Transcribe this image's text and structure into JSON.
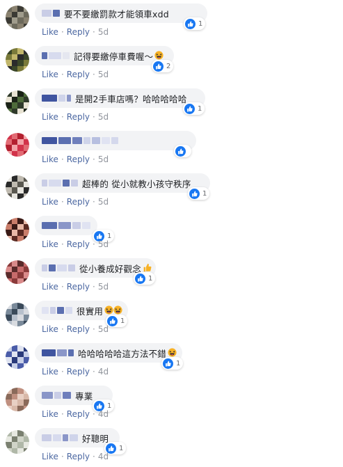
{
  "colors": {
    "like": "#1877f2",
    "link": "#4b67a1",
    "bubble": "#f2f3f5",
    "meta": "#90949c"
  },
  "comments": [
    {
      "text": "要不要繳罰款才能領車xdd",
      "trailing_emoji": "",
      "count": "1",
      "reactions": [
        "like-icon"
      ],
      "like": "Like",
      "reply": "Reply",
      "time": "5d",
      "avatar": [
        "#6d6a5c",
        "#8a8270",
        "#3b3a34",
        "#a09c8c"
      ],
      "name_blocks": [
        [
          "#c9cde6",
          14
        ],
        [
          "#5b6fb0",
          10
        ]
      ]
    },
    {
      "text": "記得要繳停車費喔～",
      "trailing_emoji": "haha-emoji",
      "count": "2",
      "reactions": [
        "like-icon"
      ],
      "like": "Like",
      "reply": "Reply",
      "time": "5d",
      "avatar": [
        "#3a4628",
        "#7a7a3a",
        "#c1b66b",
        "#2b2b2b"
      ],
      "name_blocks": [
        [
          "#5b6fb0",
          8
        ],
        [
          "#d7dbee",
          18
        ],
        [
          "#e5e7f0",
          10
        ]
      ]
    },
    {
      "text": "是開2手車店嗎？哈哈哈哈哈",
      "trailing_emoji": "",
      "count": "1",
      "reactions": [
        "like-icon"
      ],
      "like": "Like",
      "reply": "Reply",
      "time": "5d",
      "avatar": [
        "#2f3a2a",
        "#e7e2d2",
        "#1a2216",
        "#4e6b3a"
      ],
      "name_blocks": [
        [
          "#4055a0",
          22
        ],
        [
          "#cfd4ea",
          10
        ],
        [
          "#8a96c8",
          6
        ]
      ]
    },
    {
      "text": "",
      "trailing_emoji": "",
      "count": "",
      "reactions": [
        "like-icon"
      ],
      "like": "Like",
      "reply": "Reply",
      "time": "5d",
      "avatar": [
        "#d2334a",
        "#e26b74",
        "#b3202f",
        "#f2a3a8"
      ],
      "name_blocks": [
        [
          "#4055a0",
          22
        ],
        [
          "#5b6fb0",
          18
        ],
        [
          "#6f7fbc",
          14
        ],
        [
          "#cfd4ea",
          10
        ],
        [
          "#b7bfe0",
          12
        ],
        [
          "#e0e3f2",
          12
        ],
        [
          "#d4d8ec",
          10
        ]
      ]
    },
    {
      "text": "超棒的 從小就教小孩守秩序",
      "trailing_emoji": "",
      "count": "1",
      "reactions": [
        "like-icon"
      ],
      "like": "Like",
      "reply": "Reply",
      "time": "5d",
      "avatar": [
        "#e8e6e0",
        "#2a2a2a",
        "#bfbab0",
        "#5a5850"
      ],
      "name_blocks": [
        [
          "#c9cde6",
          8
        ],
        [
          "#d7dbee",
          18
        ],
        [
          "#5b6fb0",
          10
        ],
        [
          "#c9cde6",
          10
        ]
      ]
    },
    {
      "text": "",
      "trailing_emoji": "",
      "count": "1",
      "reactions": [
        "like-icon"
      ],
      "like": "Like",
      "reply": "Reply",
      "time": "5d",
      "avatar": [
        "#5a2a22",
        "#c97d6a",
        "#3a1a16",
        "#e8b8a6"
      ],
      "name_blocks": [
        [
          "#5b6fb0",
          22
        ],
        [
          "#8a96c8",
          18
        ],
        [
          "#c9cde6",
          12
        ],
        [
          "#e0e3f2",
          12
        ]
      ]
    },
    {
      "text": "從小養成好觀念",
      "trailing_emoji": "thumb-emoji",
      "count": "1",
      "reactions": [
        "like-icon"
      ],
      "like": "Like",
      "reply": "Reply",
      "time": "5d",
      "avatar": [
        "#8a3a3a",
        "#d98a8a",
        "#5a2a2a",
        "#c76b6b"
      ],
      "name_blocks": [
        [
          "#c9cde6",
          8
        ],
        [
          "#5b6fb0",
          10
        ],
        [
          "#d7dbee",
          14
        ],
        [
          "#c9cde6",
          10
        ]
      ]
    },
    {
      "text": "很實用",
      "trailing_emoji": "haha-emoji-double",
      "count": "1",
      "reactions": [
        "like-icon"
      ],
      "like": "Like",
      "reply": "Reply",
      "time": "5d",
      "avatar": [
        "#d8dbe0",
        "#7a8a9a",
        "#3a4a5a",
        "#b7c0cc"
      ],
      "name_blocks": [
        [
          "#e0e3f2",
          10
        ],
        [
          "#c9cde6",
          8
        ],
        [
          "#5b6fb0",
          10
        ],
        [
          "#d7dbee",
          10
        ]
      ]
    },
    {
      "text": "哈哈哈哈哈這方法不錯",
      "trailing_emoji": "haha-emoji",
      "count": "1",
      "reactions": [
        "like-icon"
      ],
      "like": "Like",
      "reply": "Reply",
      "time": "4d",
      "avatar": [
        "#c8d0e8",
        "#4a5ca8",
        "#dfe3f0",
        "#2a3a7a"
      ],
      "name_blocks": [
        [
          "#4055a0",
          20
        ],
        [
          "#8a96c8",
          14
        ],
        [
          "#5b6fb0",
          8
        ]
      ]
    },
    {
      "text": "專業",
      "trailing_emoji": "",
      "count": "1",
      "reactions": [
        "like-icon"
      ],
      "like": "Like",
      "reply": "Reply",
      "time": "4d",
      "avatar": [
        "#d8b8a8",
        "#8a6a5a",
        "#c09080",
        "#e8d0c4"
      ],
      "name_blocks": [
        [
          "#8a96c8",
          16
        ],
        [
          "#c9cde6",
          10
        ],
        [
          "#6f7fbc",
          12
        ]
      ]
    },
    {
      "text": "好聰明",
      "trailing_emoji": "",
      "count": "1",
      "reactions": [
        "like-icon"
      ],
      "like": "Like",
      "reply": "Reply",
      "time": "4d",
      "avatar": [
        "#b0b8a8",
        "#e6e8e0",
        "#7a8070",
        "#d0d4c8"
      ],
      "name_blocks": [
        [
          "#c9cde6",
          14
        ],
        [
          "#d7dbee",
          12
        ],
        [
          "#8a96c8",
          8
        ],
        [
          "#cfd4ea",
          12
        ]
      ]
    }
  ]
}
